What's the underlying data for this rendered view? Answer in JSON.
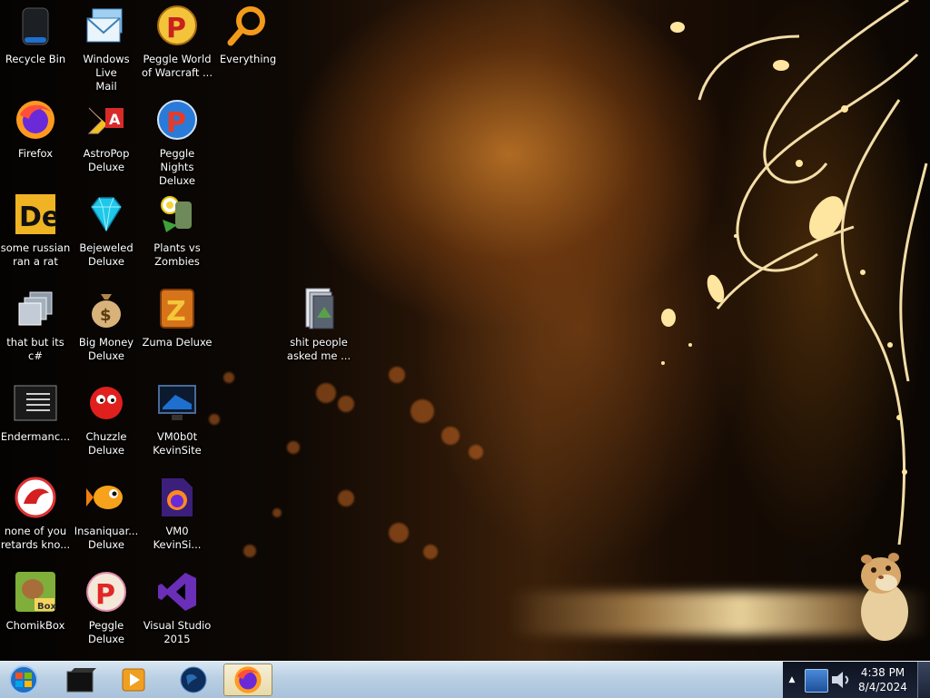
{
  "desktop": {
    "icons": [
      {
        "label": "Recycle Bin",
        "icon": "recycle-bin-icon"
      },
      {
        "label": "Windows Live\nMail",
        "icon": "windows-live-mail-icon"
      },
      {
        "label": "Peggle World\nof Warcraft ...",
        "icon": "peggle-world-of-warcraft-icon"
      },
      {
        "label": "Everything",
        "icon": "everything-search-icon"
      },
      {
        "label": "Firefox",
        "icon": "firefox-icon"
      },
      {
        "label": "AstroPop\nDeluxe",
        "icon": "astropop-icon"
      },
      {
        "label": "Peggle Nights\nDeluxe",
        "icon": "peggle-nights-icon"
      },
      {
        "label": "some russian\nran a rat",
        "icon": "de-icon"
      },
      {
        "label": "Bejeweled\nDeluxe",
        "icon": "bejeweled-icon"
      },
      {
        "label": "Plants vs\nZombies",
        "icon": "plants-vs-zombies-icon"
      },
      {
        "label": "that but its c#",
        "icon": "stacked-windows-icon"
      },
      {
        "label": "Big Money\nDeluxe",
        "icon": "money-bag-icon"
      },
      {
        "label": "Zuma Deluxe",
        "icon": "zuma-icon"
      },
      {
        "label": "shit people\nasked me ...",
        "icon": "folder-icon"
      },
      {
        "label": "Endermanc...",
        "icon": "endermanch-icon"
      },
      {
        "label": "Chuzzle\nDeluxe",
        "icon": "chuzzle-icon"
      },
      {
        "label": "VM0b0t\nKevinSite",
        "icon": "monitor-icon"
      },
      {
        "label": "none of you\nretards kno...",
        "icon": "dragon-icon"
      },
      {
        "label": "Insaniquar...\nDeluxe",
        "icon": "fish-icon"
      },
      {
        "label": "VM0\nKevinSi...",
        "icon": "firefox-file-icon"
      },
      {
        "label": "ChomikBox",
        "icon": "chomikbox-icon"
      },
      {
        "label": "Peggle Deluxe",
        "icon": "peggle-deluxe-icon"
      },
      {
        "label": "Visual Studio\n2015",
        "icon": "visual-studio-icon"
      }
    ]
  },
  "taskbar": {
    "items": [
      {
        "icon": "terminal-icon",
        "active": false
      },
      {
        "icon": "media-player-icon",
        "active": false
      },
      {
        "icon": "earth-icon",
        "active": false
      },
      {
        "icon": "firefox-icon",
        "active": true
      }
    ],
    "clock": {
      "time": "4:38 PM",
      "date": "8/4/2024"
    }
  },
  "colors": {
    "taskbar": "#b9cfe3",
    "tray": "#1b2336",
    "wallpaper_glow": "#e0a040"
  }
}
